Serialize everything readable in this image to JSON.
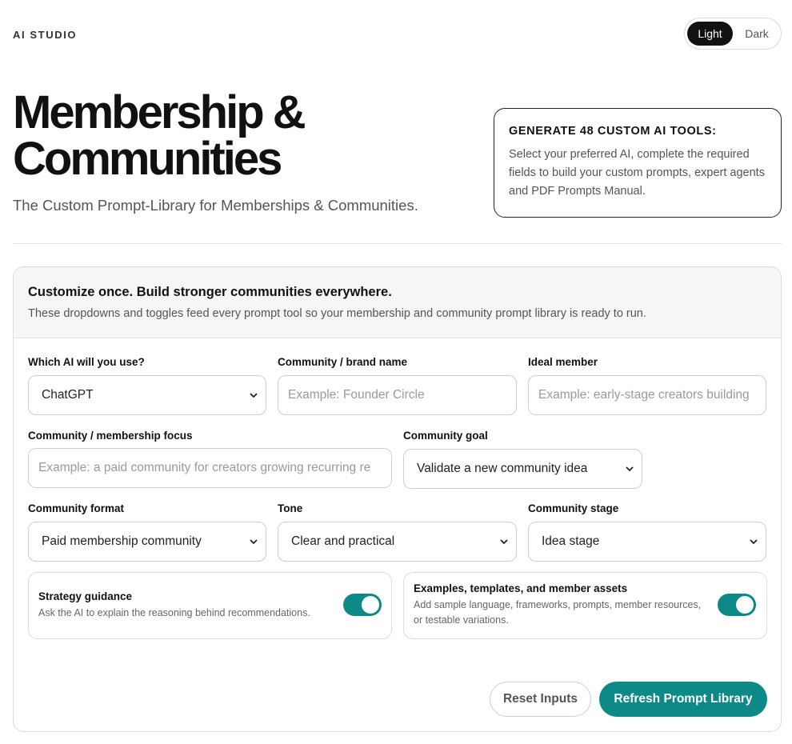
{
  "brand": "AI STUDIO",
  "theme": {
    "light_label": "Light",
    "dark_label": "Dark",
    "selected": "Light"
  },
  "hero": {
    "title_line1": "Membership &",
    "title_line2": "Communities",
    "subtitle": "The Custom Prompt-Library for Memberships & Communities."
  },
  "generate_card": {
    "title": "GENERATE 48 CUSTOM AI TOOLS:",
    "body": "Select your preferred AI, complete the required fields to build your custom prompts, expert agents and PDF Prompts Manual."
  },
  "panel": {
    "title": "Customize once. Build stronger communities everywhere.",
    "description": "These dropdowns and toggles feed every prompt tool so your membership and community prompt library is ready to run."
  },
  "fields": {
    "ai": {
      "label": "Which AI will you use?",
      "value": "ChatGPT"
    },
    "brand_name": {
      "label": "Community / brand name",
      "placeholder": "Example: Founder Circle"
    },
    "ideal_member": {
      "label": "Ideal member",
      "placeholder": "Example: early-stage creators building"
    },
    "focus": {
      "label": "Community / membership focus",
      "placeholder": "Example: a paid community for creators growing recurring re"
    },
    "goal": {
      "label": "Community goal",
      "value": "Validate a new community idea"
    },
    "format": {
      "label": "Community format",
      "value": "Paid membership community"
    },
    "tone": {
      "label": "Tone",
      "value": "Clear and practical"
    },
    "stage": {
      "label": "Community stage",
      "value": "Idea stage"
    }
  },
  "toggles": {
    "strategy": {
      "title": "Strategy guidance",
      "description": "Ask the AI to explain the reasoning behind recommendations.",
      "on": true
    },
    "examples": {
      "title": "Examples, templates, and member assets",
      "description": "Add sample language, frameworks, prompts, member resources, or testable variations.",
      "on": true
    }
  },
  "actions": {
    "reset_label": "Reset Inputs",
    "refresh_label": "Refresh Prompt Library"
  },
  "colors": {
    "accent": "#0d8a87",
    "dark": "#111111"
  }
}
